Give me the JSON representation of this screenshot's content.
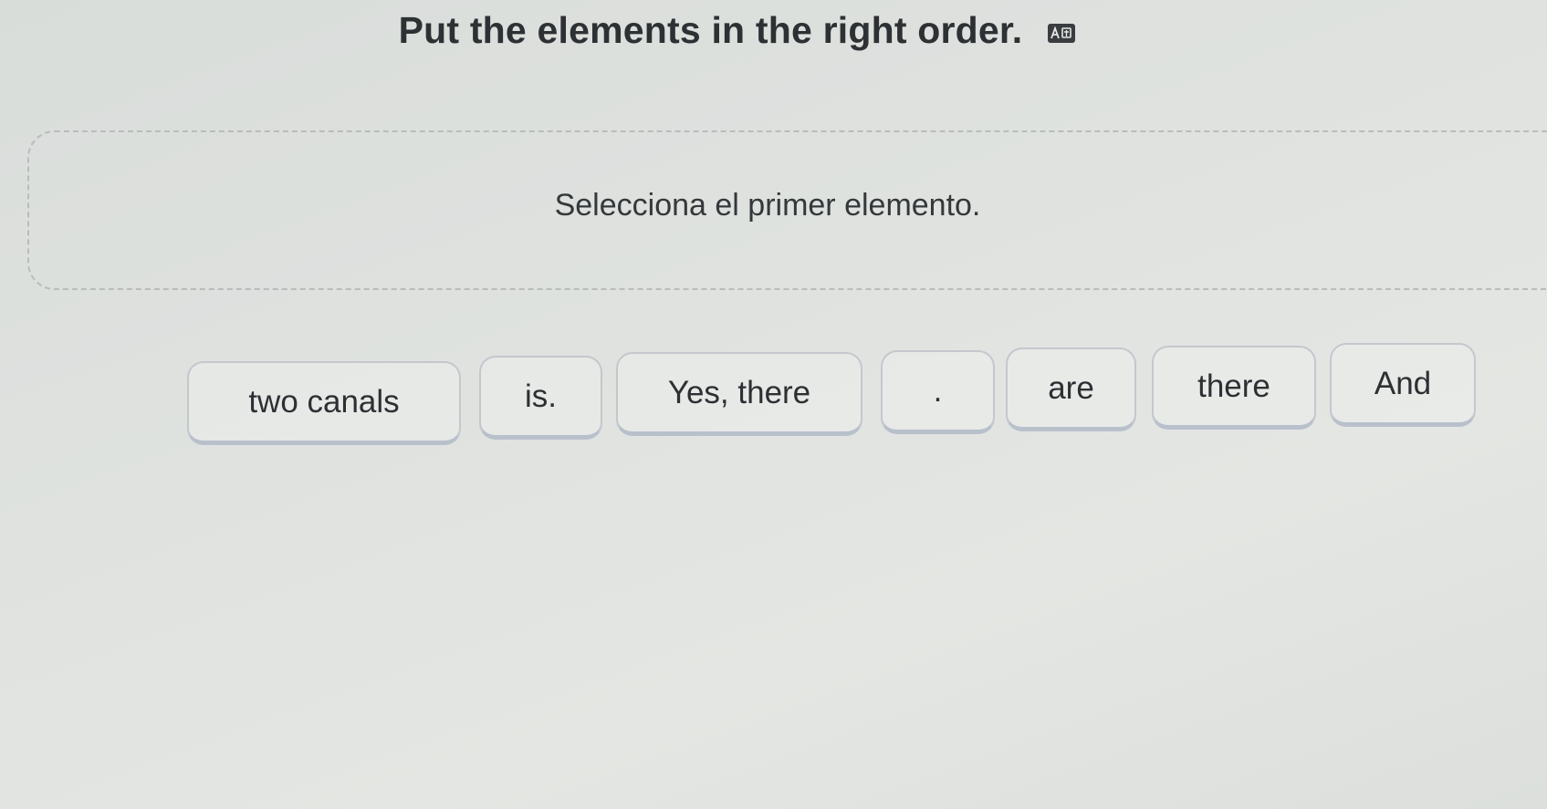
{
  "header": {
    "title": "Put the elements in the right order.",
    "translate_icon_text": "A文"
  },
  "answer_area": {
    "prompt": "Selecciona el primer elemento."
  },
  "word_bank": [
    {
      "label": "two canals"
    },
    {
      "label": "is."
    },
    {
      "label": "Yes, there"
    },
    {
      "label": "."
    },
    {
      "label": "are"
    },
    {
      "label": "there"
    },
    {
      "label": "And"
    }
  ]
}
